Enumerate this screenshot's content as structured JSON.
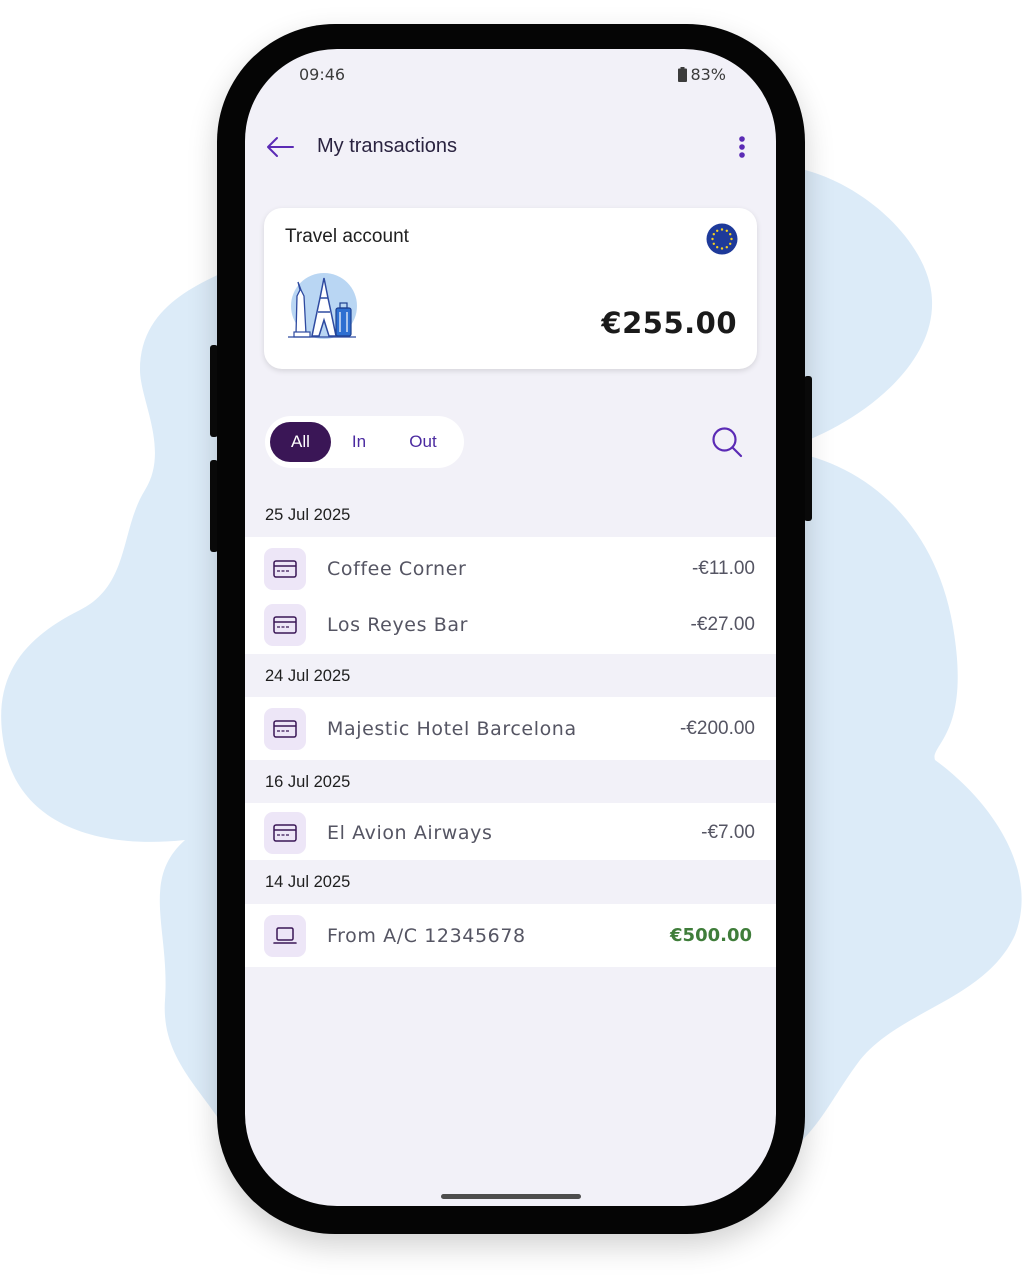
{
  "status_bar": {
    "time": "09:46",
    "battery": "83%"
  },
  "app_bar": {
    "title": "My transactions"
  },
  "account_card": {
    "name": "Travel account",
    "balance": "€255.00",
    "currency_icon": "eu-flag-icon"
  },
  "filter": {
    "all": "All",
    "in": "In",
    "out": "Out",
    "selected": "All"
  },
  "groups": [
    {
      "date": "25 Jul 2025",
      "items": [
        {
          "name": "Coffee Corner",
          "amount": "-€11.00",
          "icon": "card-icon"
        },
        {
          "name": "Los Reyes Bar",
          "amount": "-€27.00",
          "icon": "card-icon"
        }
      ]
    },
    {
      "date": "24 Jul 2025",
      "items": [
        {
          "name": "Majestic Hotel Barcelona",
          "amount": "-€200.00",
          "icon": "card-icon"
        }
      ]
    },
    {
      "date": "16 Jul 2025",
      "items": [
        {
          "name": "El Avion Airways",
          "amount": "-€7.00",
          "icon": "card-icon"
        }
      ]
    },
    {
      "date": "14 Jul 2025",
      "items": [
        {
          "name": "From A/C 12345678",
          "amount": "€500.00",
          "icon": "laptop-icon"
        }
      ]
    }
  ],
  "colors": {
    "accent": "#5b2bb5",
    "chip_selected": "#3a1656",
    "credit": "#3f7d3a",
    "screen_bg": "#f2f1f8",
    "blob": "#dcebf8"
  }
}
